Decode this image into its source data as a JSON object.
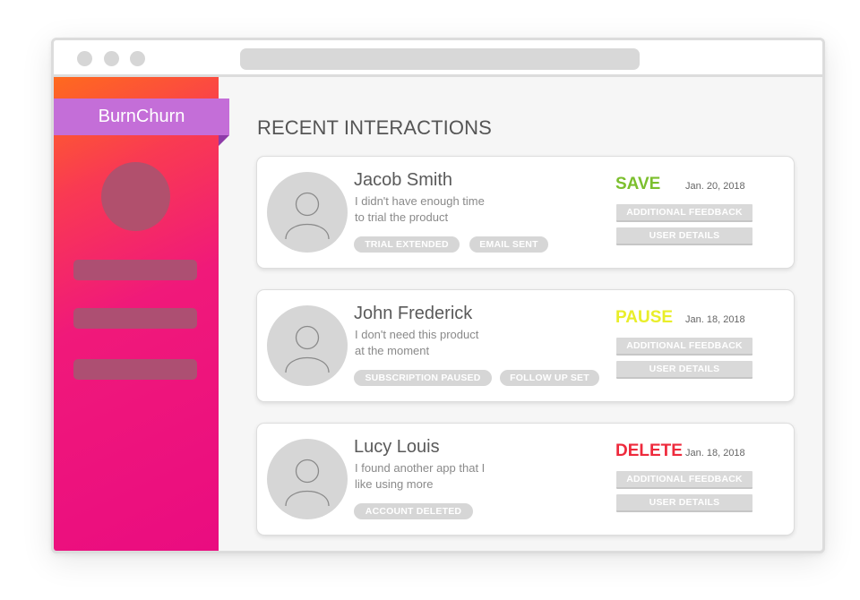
{
  "app": {
    "name": "BurnChurn"
  },
  "main": {
    "title": "RECENT INTERACTIONS"
  },
  "buttons": {
    "feedback_label": "ADDITIONAL FEEDBACK",
    "details_label": "USER DETAILS"
  },
  "interactions": [
    {
      "name": "Jacob Smith",
      "message_line1": "I didn't have enough time",
      "message_line2": "to trial the product",
      "tags": [
        "TRIAL EXTENDED",
        "EMAIL SENT"
      ],
      "status": "SAVE",
      "status_color": "#7cbf2e",
      "date": "Jan. 20, 2018"
    },
    {
      "name": "John Frederick",
      "message_line1": "I don't need this product",
      "message_line2": "at the moment",
      "tags": [
        "SUBSCRIPTION PAUSED",
        "FOLLOW UP SET"
      ],
      "status": "PAUSE",
      "status_color": "#e9ee2a",
      "date": "Jan. 18, 2018"
    },
    {
      "name": "Lucy Louis",
      "message_line1": "I found another app that I",
      "message_line2": "like using more",
      "tags": [
        "ACCOUNT DELETED"
      ],
      "status": "DELETE",
      "status_color": "#ee2a3c",
      "date": "Jan. 18, 2018"
    }
  ],
  "icons": {
    "avatar": "user-icon"
  }
}
